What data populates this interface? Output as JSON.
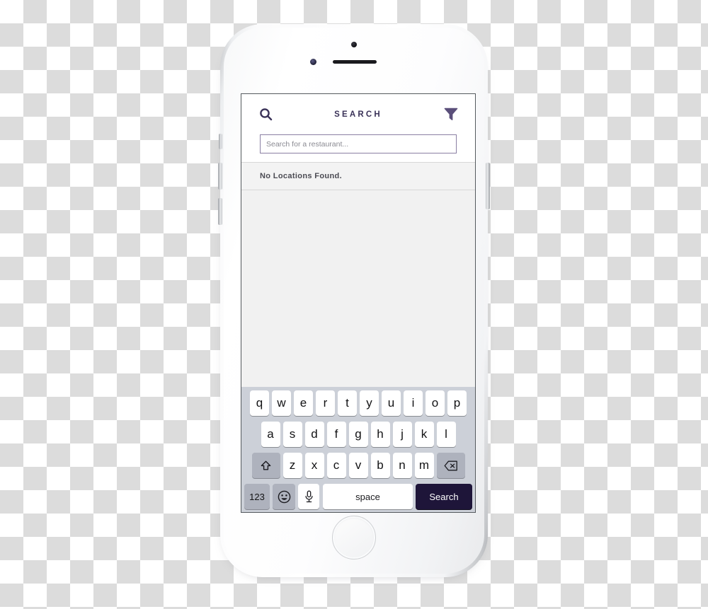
{
  "device": {
    "name": "iphone-mockup",
    "camera": "front-camera",
    "speaker": "earpiece-speaker",
    "sensor": "proximity-sensor",
    "home_button": "home-button",
    "buttons": [
      "silent-switch",
      "volume-up",
      "volume-down",
      "power"
    ]
  },
  "app": {
    "header": {
      "title": "SEARCH",
      "search_icon": "search-icon",
      "filter_icon": "filter-funnel-icon"
    },
    "search": {
      "value": "",
      "placeholder": "Search for a restaurant..."
    },
    "results": {
      "empty_message": "No Locations Found."
    }
  },
  "keyboard": {
    "rows": [
      [
        "q",
        "w",
        "e",
        "r",
        "t",
        "y",
        "u",
        "i",
        "o",
        "p"
      ],
      [
        "a",
        "s",
        "d",
        "f",
        "g",
        "h",
        "j",
        "k",
        "l"
      ],
      [
        "z",
        "x",
        "c",
        "v",
        "b",
        "n",
        "m"
      ]
    ],
    "shift_label": "⇧",
    "backspace_label": "⌫",
    "numbers_label": "123",
    "emoji_label": "😀",
    "mic_label": "mic",
    "space_label": "space",
    "action_label": "Search"
  },
  "colors": {
    "accent": "#3a3258",
    "action_key": "#1e1539",
    "input_border": "#8a7fa3",
    "keyboard_bg": "#ccd0d8",
    "key_grey": "#aeb2bd",
    "screen_bg": "#f1f1f1"
  }
}
